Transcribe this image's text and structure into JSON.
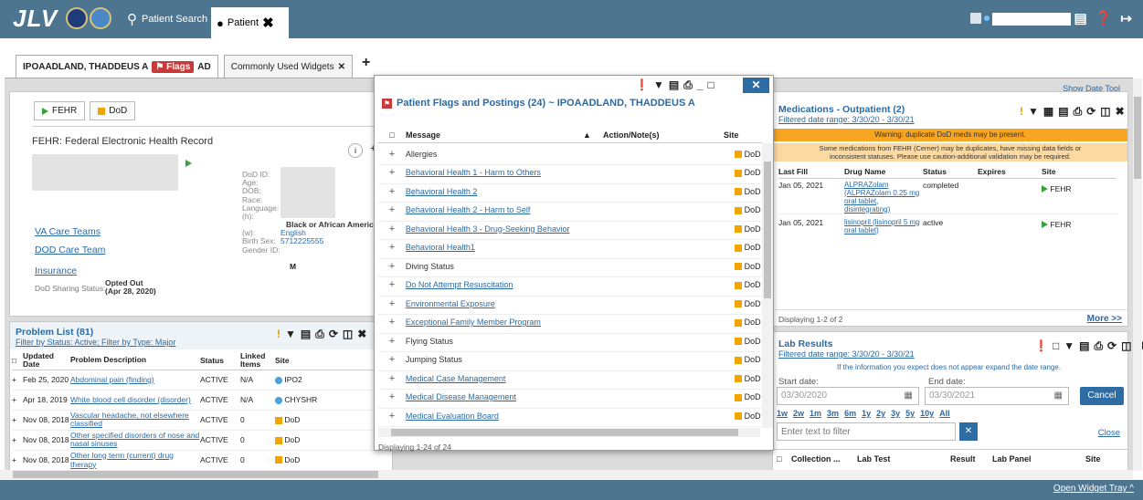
{
  "app": {
    "logo": "JLV"
  },
  "topbar": {
    "patient_search": "Patient Search",
    "patient_tab": "Patient",
    "icons": [
      "users-icon",
      "gear-icon",
      "notes-icon",
      "help-icon",
      "logout-icon"
    ]
  },
  "tabs": {
    "patient_name": "IPOAADLAND, THADDEUS A",
    "flags": "Flags",
    "ad": "AD",
    "widgets_tab": "Commonly Used Widgets"
  },
  "demographics": {
    "tab_fehr": "FEHR",
    "tab_dod": "DoD",
    "heading": "FEHR: Federal Electronic Health Record",
    "labels": [
      "DoD ID:",
      "Age:",
      "DOB:",
      "Race:",
      "Language:",
      "(h):",
      "(w):",
      "Birth Sex:",
      "Gender ID:"
    ],
    "race": "Black or African American",
    "language": "English",
    "phone_h": "5712225555",
    "birth_sex": "M",
    "links": [
      "VA Care Teams",
      "DOD Care Team",
      "Insurance"
    ],
    "sharing_label": "DoD Sharing Status:",
    "sharing_value": "Opted Out",
    "sharing_date": "(Apr 28, 2020)"
  },
  "problem_list": {
    "title": "Problem List (81)",
    "filter": "Filter by Status: Active; Filter by Type: Major",
    "columns": [
      "Updated Date",
      "Problem Description",
      "Status",
      "Linked Items",
      "Site"
    ],
    "rows": [
      {
        "date": "Feb 25, 2020",
        "desc": "Abdominal pain (finding)",
        "status": "ACTIVE",
        "linked": "N/A",
        "site": "IPO2"
      },
      {
        "date": "Apr 18, 2019",
        "desc": "White blood cell disorder (disorder)",
        "status": "ACTIVE",
        "linked": "N/A",
        "site": "CHYSHR"
      },
      {
        "date": "Nov 08, 2018",
        "desc": "Vascular headache, not elsewhere classified",
        "status": "ACTIVE",
        "linked": "0",
        "site": "DoD"
      },
      {
        "date": "Nov 08, 2018",
        "desc": "Other specified disorders of nose and nasal sinuses",
        "status": "ACTIVE",
        "linked": "0",
        "site": "DoD"
      },
      {
        "date": "Nov 08, 2018",
        "desc": "Other long term (current) drug therapy",
        "status": "ACTIVE",
        "linked": "0",
        "site": "DoD"
      }
    ]
  },
  "modal": {
    "title": "Patient Flags and Postings (24) ~ IPOAADLAND, THADDEUS A",
    "columns": [
      "Message",
      "Action/Note(s)",
      "Site"
    ],
    "rows": [
      {
        "msg": "Allergies",
        "link": false
      },
      {
        "msg": "Behavioral Health 1 - Harm to Others",
        "link": true
      },
      {
        "msg": "Behavioral Health 2",
        "link": true
      },
      {
        "msg": "Behavioral Health 2 - Harm to Self",
        "link": true
      },
      {
        "msg": "Behavioral Health 3 - Drug-Seeking Behavior",
        "link": true
      },
      {
        "msg": "Behavioral Health1",
        "link": true
      },
      {
        "msg": "Diving Status",
        "link": false
      },
      {
        "msg": "Do Not Attempt Resuscitation",
        "link": true
      },
      {
        "msg": "Environmental Exposure",
        "link": true
      },
      {
        "msg": "Exceptional Family Member Program",
        "link": true
      },
      {
        "msg": "Flying Status",
        "link": false
      },
      {
        "msg": "Jumping Status",
        "link": false
      },
      {
        "msg": "Medical Case Management",
        "link": true
      },
      {
        "msg": "Medical Disease Management",
        "link": true
      },
      {
        "msg": "Medical Evaluation Board",
        "link": true
      }
    ],
    "site": "DoD",
    "footer": "Displaying 1-24 of 24"
  },
  "medications": {
    "show_date_tool": "Show Date Tool",
    "title": "Medications - Outpatient (2)",
    "filter": "Filtered date range: 3/30/20 - 3/30/21",
    "warning1": "Warning: duplicate DoD meds may be present.",
    "warning2": "Some medications from FEHR (Cerner) may be duplicates, have missing data fields or inconsistent statuses. Please use caution-additional validation may be required.",
    "columns": [
      "Last Fill",
      "Drug Name",
      "Status",
      "Expires",
      "Site"
    ],
    "rows": [
      {
        "fill": "Jan 05, 2021",
        "drug": "ALPRAZolam (ALPRAZolam 0.25 mg oral tablet, disintegrating)",
        "status": "completed",
        "site": "FEHR"
      },
      {
        "fill": "Jan 05, 2021",
        "drug": "lisinopril (lisinopril 5 mg oral tablet)",
        "status": "active",
        "site": "FEHR"
      }
    ],
    "footer": "Displaying 1-2 of 2",
    "more": "More >>"
  },
  "labs": {
    "title": "Lab Results",
    "filter": "Filtered date range: 3/30/20 - 3/30/21",
    "info": "If the information you expect does not appear expand the date range.",
    "start_label": "Start date:",
    "start_value": "03/30/2020",
    "end_label": "End date:",
    "end_value": "03/30/2021",
    "cancel": "Cancel",
    "ranges": [
      "1w",
      "2w",
      "1m",
      "3m",
      "6m",
      "1y",
      "2y",
      "3y",
      "5y",
      "10y",
      "All"
    ],
    "filter_placeholder": "Enter text to filter",
    "close": "Close",
    "columns": [
      "Collection ...",
      "Lab Test",
      "Result",
      "Lab Panel",
      "Site"
    ]
  },
  "footer": {
    "open_widget_tray": "Open Widget Tray"
  }
}
